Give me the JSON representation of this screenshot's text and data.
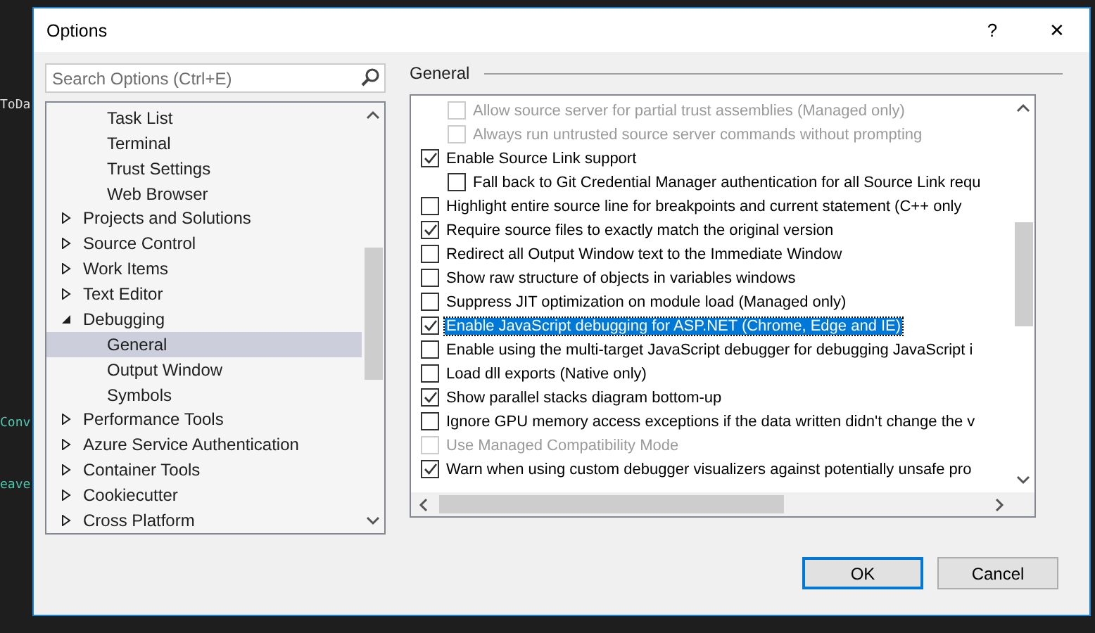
{
  "editor": {
    "lines": [
      {
        "text": "ToDa",
        "color": "#dcdcdc"
      },
      {
        "text": "Conv",
        "color": "#4ec9b0"
      },
      {
        "text": "eave",
        "color": "#4ec9b0"
      }
    ]
  },
  "window": {
    "title": "Options",
    "help": "?",
    "close": "✕"
  },
  "search": {
    "placeholder": "Search Options (Ctrl+E)"
  },
  "tree": [
    {
      "children": [
        {
          "label": "Task List",
          "selected": false
        },
        {
          "label": "Terminal",
          "selected": false
        },
        {
          "label": "Trust Settings",
          "selected": false
        },
        {
          "label": "Web Browser",
          "selected": false
        }
      ]
    },
    {
      "label": "Projects and Solutions",
      "expanded": false,
      "selected": false
    },
    {
      "label": "Source Control",
      "expanded": false,
      "selected": false
    },
    {
      "label": "Work Items",
      "expanded": false,
      "selected": false
    },
    {
      "label": "Text Editor",
      "expanded": false,
      "selected": false
    },
    {
      "label": "Debugging",
      "expanded": true,
      "selected": false,
      "children": [
        {
          "label": "General",
          "selected": true
        },
        {
          "label": "Output Window",
          "selected": false
        },
        {
          "label": "Symbols",
          "selected": false
        }
      ]
    },
    {
      "label": "Performance Tools",
      "expanded": false,
      "selected": false
    },
    {
      "label": "Azure Service Authentication",
      "expanded": false,
      "selected": false
    },
    {
      "label": "Container Tools",
      "expanded": false,
      "selected": false
    },
    {
      "label": "Cookiecutter",
      "expanded": false,
      "selected": false
    },
    {
      "label": "Cross Platform",
      "expanded": false,
      "selected": false
    }
  ],
  "section": {
    "title": "General"
  },
  "options": [
    {
      "children": [
        {
          "label": "Allow source server for partial trust assemblies (Managed only)",
          "checked": false,
          "disabled": true,
          "selected": false
        },
        {
          "label": "Always run untrusted source server commands without prompting",
          "checked": false,
          "disabled": true,
          "selected": false
        }
      ]
    },
    {
      "label": "Enable Source Link support",
      "checked": true,
      "disabled": false,
      "selected": false,
      "children": [
        {
          "label": "Fall back to Git Credential Manager authentication for all Source Link requ",
          "checked": false,
          "disabled": false,
          "selected": false
        }
      ]
    },
    {
      "label": "Highlight entire source line for breakpoints and current statement (C++ only",
      "checked": false,
      "disabled": false,
      "selected": false
    },
    {
      "label": "Require source files to exactly match the original version",
      "checked": true,
      "disabled": false,
      "selected": false
    },
    {
      "label": "Redirect all Output Window text to the Immediate Window",
      "checked": false,
      "disabled": false,
      "selected": false
    },
    {
      "label": "Show raw structure of objects in variables windows",
      "checked": false,
      "disabled": false,
      "selected": false
    },
    {
      "label": "Suppress JIT optimization on module load (Managed only)",
      "checked": false,
      "disabled": false,
      "selected": false
    },
    {
      "label": "Enable JavaScript debugging for ASP.NET (Chrome, Edge and IE)",
      "checked": true,
      "disabled": false,
      "selected": true
    },
    {
      "label": "Enable using the multi-target JavaScript debugger for debugging JavaScript i",
      "checked": false,
      "disabled": false,
      "selected": false
    },
    {
      "label": "Load dll exports (Native only)",
      "checked": false,
      "disabled": false,
      "selected": false
    },
    {
      "label": "Show parallel stacks diagram bottom-up",
      "checked": true,
      "disabled": false,
      "selected": false
    },
    {
      "label": "Ignore GPU memory access exceptions if the data written didn't change the v",
      "checked": false,
      "disabled": false,
      "selected": false
    },
    {
      "label": "Use Managed Compatibility Mode",
      "checked": false,
      "disabled": true,
      "selected": false
    },
    {
      "label": "Warn when using custom debugger visualizers against potentially unsafe pro",
      "checked": true,
      "disabled": false,
      "selected": false
    }
  ],
  "buttons": [
    {
      "label": "OK",
      "default": true
    },
    {
      "label": "Cancel",
      "default": false
    }
  ]
}
